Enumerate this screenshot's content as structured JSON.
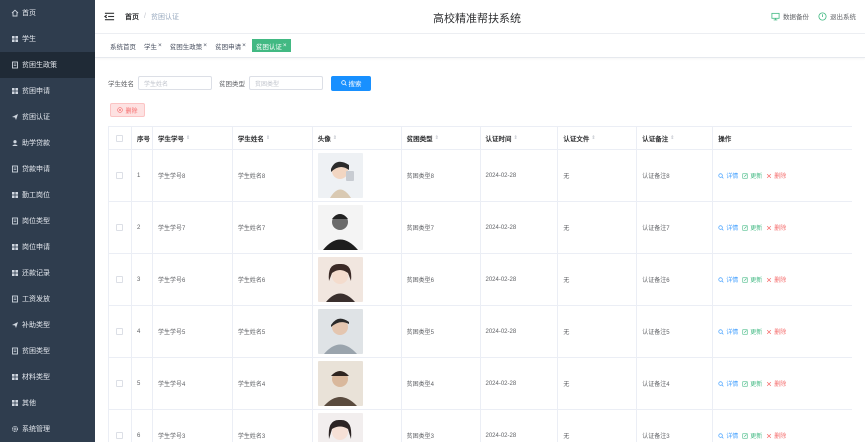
{
  "sidebar": {
    "items": [
      {
        "label": "首页",
        "icon": "home-icon"
      },
      {
        "label": "学生",
        "icon": "grid-icon"
      },
      {
        "label": "贫困生政策",
        "icon": "doc-icon",
        "active": true
      },
      {
        "label": "贫困申请",
        "icon": "grid-icon"
      },
      {
        "label": "贫困认证",
        "icon": "send-icon"
      },
      {
        "label": "助学贷款",
        "icon": "user-icon"
      },
      {
        "label": "贷款申请",
        "icon": "doc-icon"
      },
      {
        "label": "勤工岗位",
        "icon": "grid-icon"
      },
      {
        "label": "岗位类型",
        "icon": "doc-icon"
      },
      {
        "label": "岗位申请",
        "icon": "grid-icon"
      },
      {
        "label": "还款记录",
        "icon": "grid-icon"
      },
      {
        "label": "工资发放",
        "icon": "doc-icon"
      },
      {
        "label": "补助类型",
        "icon": "send-icon"
      },
      {
        "label": "贫困类型",
        "icon": "doc-icon"
      },
      {
        "label": "材料类型",
        "icon": "grid-icon"
      },
      {
        "label": "其他",
        "icon": "grid-icon"
      },
      {
        "label": "系统管理",
        "icon": "gear-icon"
      }
    ]
  },
  "header": {
    "breadcrumb_home": "首页",
    "breadcrumb_current": "贫困认证",
    "title": "高校精准帮扶系统",
    "backup_label": "数据备份",
    "logout_label": "退出系统"
  },
  "tags": [
    {
      "label": "系统首页",
      "closable": false
    },
    {
      "label": "学生",
      "closable": true
    },
    {
      "label": "贫困生政策",
      "closable": true
    },
    {
      "label": "贫困申请",
      "closable": true
    },
    {
      "label": "贫困认证",
      "closable": true,
      "active": true
    }
  ],
  "search": {
    "name_label": "学生姓名",
    "name_placeholder": "学生姓名",
    "type_label": "贫困类型",
    "type_placeholder": "贫困类型",
    "button_label": "搜索"
  },
  "delete_button_label": "删除",
  "table": {
    "headers": [
      "序号",
      "学生学号",
      "学生姓名",
      "头像",
      "贫困类型",
      "认证时间",
      "认证文件",
      "认证备注",
      "操作"
    ],
    "ops": {
      "detail": "详情",
      "edit": "更新",
      "delete": "删除"
    },
    "rows": [
      {
        "idx": "1",
        "sid": "学生学号8",
        "name": "学生姓名8",
        "type": "贫困类型8",
        "time": "2024-02-28",
        "file": "无",
        "note": "认证备注8"
      },
      {
        "idx": "2",
        "sid": "学生学号7",
        "name": "学生姓名7",
        "type": "贫困类型7",
        "time": "2024-02-28",
        "file": "无",
        "note": "认证备注7"
      },
      {
        "idx": "3",
        "sid": "学生学号6",
        "name": "学生姓名6",
        "type": "贫困类型6",
        "time": "2024-02-28",
        "file": "无",
        "note": "认证备注6"
      },
      {
        "idx": "4",
        "sid": "学生学号5",
        "name": "学生姓名5",
        "type": "贫困类型5",
        "time": "2024-02-28",
        "file": "无",
        "note": "认证备注5"
      },
      {
        "idx": "5",
        "sid": "学生学号4",
        "name": "学生姓名4",
        "type": "贫困类型4",
        "time": "2024-02-28",
        "file": "无",
        "note": "认证备注4"
      },
      {
        "idx": "6",
        "sid": "学生学号3",
        "name": "学生姓名3",
        "type": "贫困类型3",
        "time": "2024-02-28",
        "file": "无",
        "note": "认证备注3"
      }
    ]
  },
  "colors": {
    "sidebar_bg": "#2f3d4e",
    "accent_green": "#42b983",
    "primary_blue": "#1890ff",
    "danger_red": "#f56c6c"
  }
}
